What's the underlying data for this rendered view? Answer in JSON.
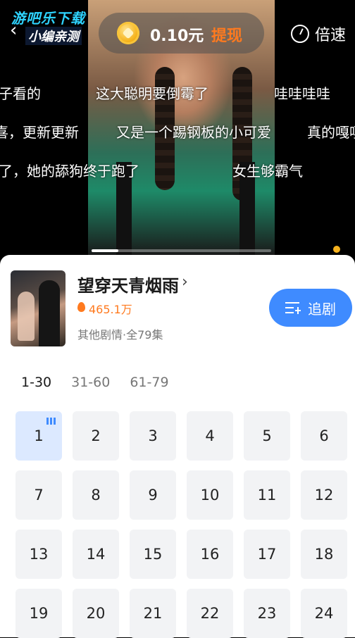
{
  "watermark": {
    "line1": "游吧乐下载",
    "line2": "小编亲测"
  },
  "header": {
    "coin_amount": "0.10元",
    "withdraw_label": "提现",
    "speed_label": "倍速"
  },
  "danmaku": [
    "子看的",
    "这大聪明要倒霉了",
    "哇哇哇哇",
    "喜，更新更新",
    "又是一个踢钢板的小可爱",
    "真的嘎嘎",
    "了，她的舔狗终于跑了",
    "女生够霸气"
  ],
  "player": {
    "progress": 0.15
  },
  "drama": {
    "title": "望穿天青烟雨",
    "heat": "465.1万",
    "meta": "其他剧情·全79集",
    "follow_label": "追剧"
  },
  "ranges": [
    "1-30",
    "31-60",
    "61-79"
  ],
  "episodes": [
    "1",
    "2",
    "3",
    "4",
    "5",
    "6",
    "7",
    "8",
    "9",
    "10",
    "11",
    "12",
    "13",
    "14",
    "15",
    "16",
    "17",
    "18",
    "19",
    "20",
    "21",
    "22",
    "23",
    "24"
  ],
  "colors": {
    "accent": "#3f8bff",
    "orange": "#ff7a1f",
    "coin": "#f5b21a"
  },
  "icons": {
    "back": "chevron-left-icon",
    "coin": "coin-icon",
    "speed": "speed-icon",
    "title_more": "chevron-right-icon",
    "fire": "fire-icon",
    "follow": "playlist-add-icon",
    "playing": "equalizer-icon"
  }
}
